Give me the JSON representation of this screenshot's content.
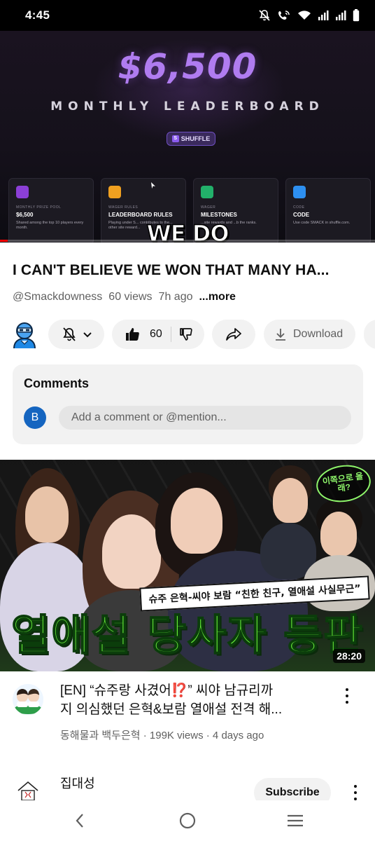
{
  "status_bar": {
    "time": "4:45",
    "icons": [
      "mute-icon",
      "wifi-call-icon",
      "wifi-icon",
      "signal-icon",
      "signal-icon",
      "battery-icon"
    ]
  },
  "video": {
    "thumbnail": {
      "amount": "$6,500",
      "heading": "MONTHLY LEADERBOARD",
      "brand": "SHUFFLE",
      "cards": [
        {
          "kicker": "MONTHLY PRIZE POOL",
          "title": "$6,500",
          "desc": "Shared among the top 10 players every month.",
          "color": "#8b3fd6"
        },
        {
          "kicker": "WAGER RULES",
          "title": "LEADERBOARD RULES",
          "desc": "Playing under S... contributes to the... other site reward...",
          "color": "#f0a020"
        },
        {
          "kicker": "WAGER",
          "title": "MILESTONES",
          "desc": "...site rewards and ...b the ranks.",
          "color": "#22b06a"
        },
        {
          "kicker": "CODE",
          "title": "CODE",
          "desc": "Use code SMACK in shuffle.com.",
          "color": "#2d8ff0"
        }
      ],
      "caption": "WE DO"
    },
    "progress": 0.02,
    "title": "I CAN'T BELIEVE WE WON THAT MANY HA...",
    "channel": "@Smackdowness",
    "views": "60 views",
    "age": "7h ago",
    "more_label": "...more",
    "likes": "60",
    "download_label": "Download"
  },
  "comments": {
    "title": "Comments",
    "user_initial": "B",
    "placeholder": "Add a comment or @mention..."
  },
  "recommended": {
    "thumbnail": {
      "bubble_text": "이쪽으로 올래?",
      "banner": "슈주 은혁-씨야 보람 “친한 친구, 열애설 사실무근”",
      "headline": "열애설 당사자 등판",
      "duration": "28:20"
    },
    "title_line1": "[EN] “슈주랑 사겼어⁉️” 씨야 남규리까",
    "title_line2": "지 의심했던 은혁&보람 열애설 전격 해...",
    "meta": "동해물과 백두은혁 · 199K views · 4 days ago"
  },
  "next_channel": {
    "name": "집대성",
    "subscribe_label": "Subscribe"
  },
  "colors": {
    "accent_red": "#ff0000",
    "neon_green": "#69f03a",
    "purple": "#b07cf0"
  }
}
